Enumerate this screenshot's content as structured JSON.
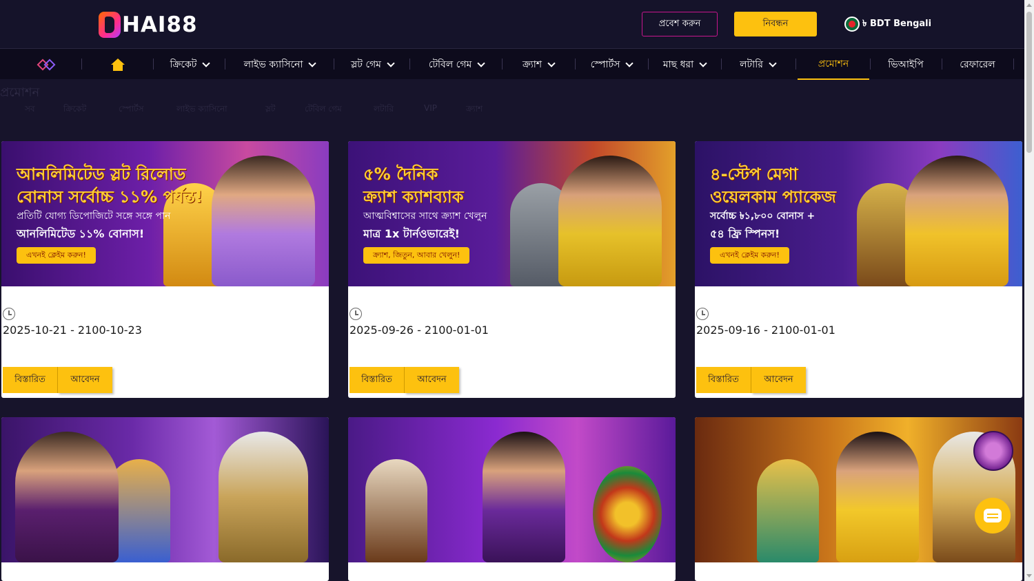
{
  "header": {
    "logo_text": "HAI88",
    "login_label": "প্রবেশ করুন",
    "register_label": "নিবন্ধন",
    "currency_label": "৳ BDT Bengali"
  },
  "nav": {
    "items": [
      {
        "label": "ক্রিকেট"
      },
      {
        "label": "লাইভ ক্যাসিনো"
      },
      {
        "label": "স্লট গেম"
      },
      {
        "label": "টেবিল গেম"
      },
      {
        "label": "ক্র্যাশ"
      },
      {
        "label": "স্পোর্টস"
      },
      {
        "label": "মাছ ধরা"
      },
      {
        "label": "লটারি"
      },
      {
        "label": "প্রমোশন"
      },
      {
        "label": "ভিআইপি"
      },
      {
        "label": "রেফারেল"
      }
    ],
    "active": "প্রমোশন"
  },
  "page": {
    "title": "প্রমোশন",
    "filters": [
      "সব",
      "ক্রিকেট",
      "স্পোর্টস",
      "লাইভ ক্যাসিনো",
      "স্লট",
      "টেবিল গেম",
      "লটারি",
      "VIP",
      "ক্র্যাশ"
    ]
  },
  "promotions": [
    {
      "headline_1": "আনলিমিটেড স্লট রিলোড",
      "headline_2": "বোনাস সর্বোচ্চ ১১% পর্যন্ত!",
      "sub_1": "প্রতিটি যোগ্য ডিপোজিটে সঙ্গে সঙ্গে পান",
      "sub_2": "আনলিমিটেড ১১% বোনাস!",
      "cta": "এখনই ক্লেইম করুন!",
      "date": "2025-10-21 - 2100-10-23",
      "details_label": "বিস্তারিত",
      "apply_label": "আবেদন",
      "bg": "#5a1c8f"
    },
    {
      "headline_1": "৫% দৈনিক",
      "headline_2": "ক্র্যাশ ক্যাশব্যাক",
      "sub_1": "আত্মবিশ্বাসের সাথে ক্র্যাশ খেলুন",
      "sub_2": "মাত্র 1x টার্নওভারেই!",
      "cta": "ক্র্যাশ, জিতুন, আবার খেলুন!",
      "date": "2025-09-26 - 2100-01-01",
      "details_label": "বিস্তারিত",
      "apply_label": "আবেদন",
      "bg": "#4a1a86"
    },
    {
      "headline_1": "৪-স্টেপ মেগা",
      "headline_2": "ওয়েলকাম প্যাকেজ",
      "sub_1": "সর্বোচ্চ ৳১,৮০০ বোনাস +",
      "sub_2": "৫৪ ফ্রি স্পিনস!",
      "cta": "এখনই ক্লেইম করুন!",
      "date": "2025-09-16 - 2100-01-01",
      "details_label": "বিস্তারিত",
      "apply_label": "আবেদন",
      "bg": "#3f1b8a"
    }
  ],
  "colors": {
    "accent": "#fdc10f",
    "page_bg": "#17142b",
    "header_bg": "#15132a",
    "nav_bg": "#0d0b1c"
  }
}
